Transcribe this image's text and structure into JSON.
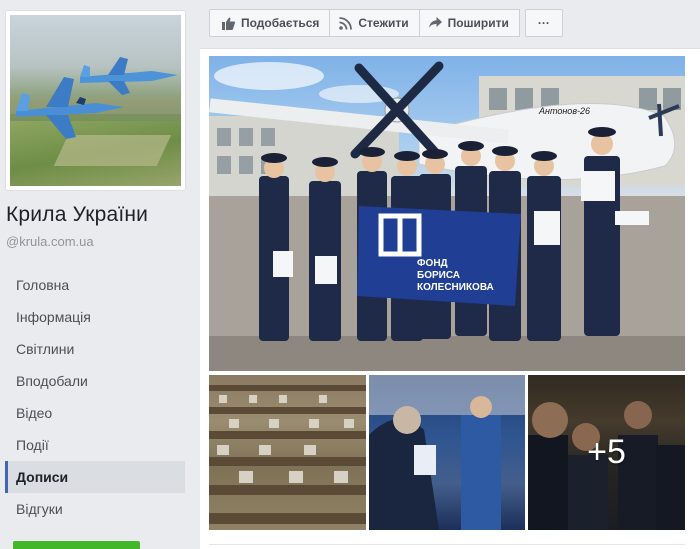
{
  "page": {
    "name": "Крила України",
    "username": "@krula.com.ua"
  },
  "nav": {
    "items": [
      "Головна",
      "Інформація",
      "Світлини",
      "Вподобали",
      "Відео",
      "Події",
      "Дописи",
      "Відгуки"
    ],
    "active": "Дописи"
  },
  "actions": {
    "like": "Подобається",
    "follow": "Стежити",
    "share": "Поширити",
    "more": "···"
  },
  "photos": {
    "more_count": "+5",
    "plane_label": "Антонов-26",
    "flag_line1": "ФОНД",
    "flag_line2": "БОРИСА",
    "flag_line3": "КОЛЕСНИКОВА"
  },
  "colors": {
    "accent": "#4267b2",
    "cta_green": "#42b72a"
  }
}
